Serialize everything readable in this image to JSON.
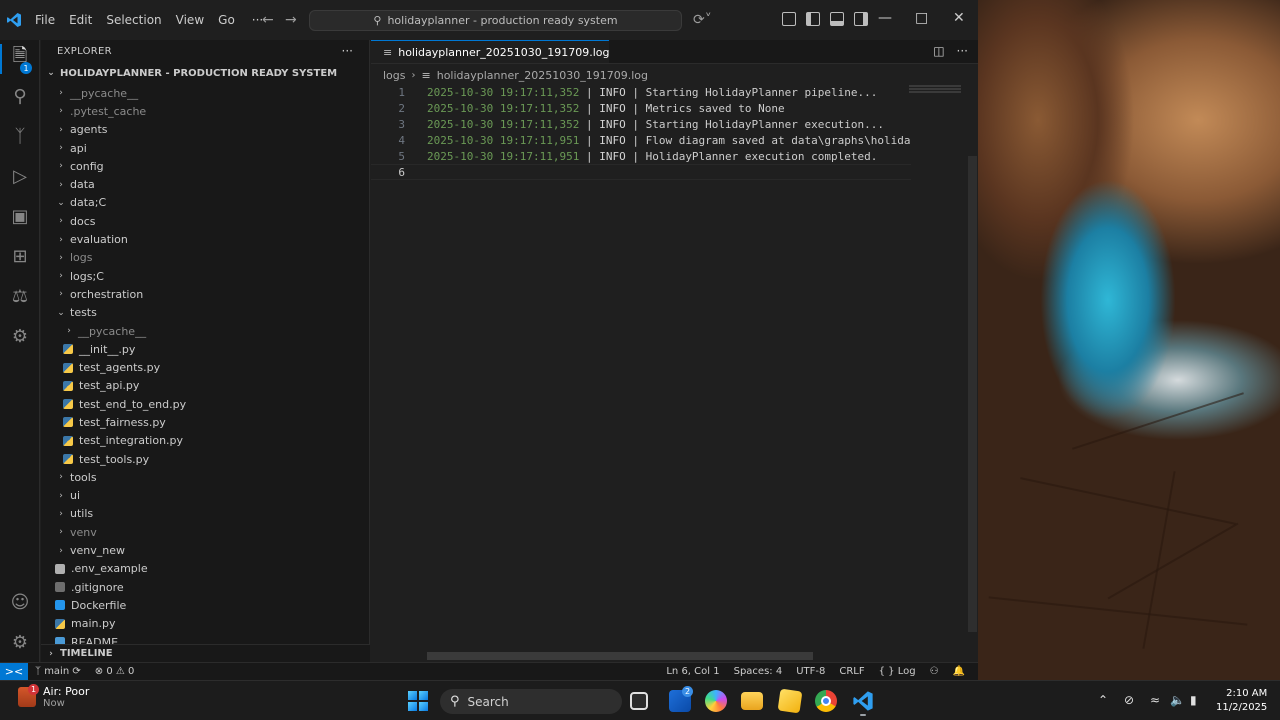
{
  "menu": {
    "file": "File",
    "edit": "Edit",
    "selection": "Selection",
    "view": "View",
    "go": "Go",
    "more": "···"
  },
  "command_center": {
    "text": "holidayplanner - production ready system"
  },
  "activity": {
    "explorer_badge": "1"
  },
  "sidebar": {
    "title": "EXPLORER",
    "more": "···",
    "root": "HOLIDAYPLANNER - PRODUCTION READY SYSTEM",
    "items": [
      {
        "label": "__pycache__",
        "type": "folder",
        "dim": true,
        "depth": 1,
        "open": false
      },
      {
        "label": ".pytest_cache",
        "type": "folder",
        "dim": true,
        "depth": 1,
        "open": false
      },
      {
        "label": "agents",
        "type": "folder",
        "dim": false,
        "depth": 1,
        "open": false
      },
      {
        "label": "api",
        "type": "folder",
        "dim": false,
        "depth": 1,
        "open": false
      },
      {
        "label": "config",
        "type": "folder",
        "dim": false,
        "depth": 1,
        "open": false
      },
      {
        "label": "data",
        "type": "folder",
        "dim": false,
        "depth": 1,
        "open": false
      },
      {
        "label": "data;C",
        "type": "folder",
        "dim": false,
        "depth": 1,
        "open": true
      },
      {
        "label": "docs",
        "type": "folder",
        "dim": false,
        "depth": 1,
        "open": false
      },
      {
        "label": "evaluation",
        "type": "folder",
        "dim": false,
        "depth": 1,
        "open": false
      },
      {
        "label": "logs",
        "type": "folder",
        "dim": true,
        "depth": 1,
        "open": false
      },
      {
        "label": "logs;C",
        "type": "folder",
        "dim": false,
        "depth": 1,
        "open": false
      },
      {
        "label": "orchestration",
        "type": "folder",
        "dim": false,
        "depth": 1,
        "open": false
      },
      {
        "label": "tests",
        "type": "folder",
        "dim": false,
        "depth": 1,
        "open": true
      },
      {
        "label": "__pycache__",
        "type": "folder",
        "dim": true,
        "depth": 2,
        "open": false
      },
      {
        "label": "__init__.py",
        "type": "py",
        "dim": false,
        "depth": 2
      },
      {
        "label": "test_agents.py",
        "type": "py",
        "dim": false,
        "depth": 2
      },
      {
        "label": "test_api.py",
        "type": "py",
        "dim": false,
        "depth": 2
      },
      {
        "label": "test_end_to_end.py",
        "type": "py",
        "dim": false,
        "depth": 2
      },
      {
        "label": "test_fairness.py",
        "type": "py",
        "dim": false,
        "depth": 2
      },
      {
        "label": "test_integration.py",
        "type": "py",
        "dim": false,
        "depth": 2
      },
      {
        "label": "test_tools.py",
        "type": "py",
        "dim": false,
        "depth": 2
      },
      {
        "label": "tools",
        "type": "folder",
        "dim": false,
        "depth": 1,
        "open": false
      },
      {
        "label": "ui",
        "type": "folder",
        "dim": false,
        "depth": 1,
        "open": false
      },
      {
        "label": "utils",
        "type": "folder",
        "dim": false,
        "depth": 1,
        "open": false
      },
      {
        "label": "venv",
        "type": "folder",
        "dim": true,
        "depth": 1,
        "open": false
      },
      {
        "label": "venv_new",
        "type": "folder",
        "dim": false,
        "depth": 1,
        "open": false
      },
      {
        "label": ".env_example",
        "type": "env",
        "dim": false,
        "depth": 1
      },
      {
        "label": ".gitignore",
        "type": "git",
        "dim": false,
        "depth": 1
      },
      {
        "label": "Dockerfile",
        "type": "docker",
        "dim": false,
        "depth": 1
      },
      {
        "label": "main.py",
        "type": "py",
        "dim": false,
        "depth": 1
      },
      {
        "label": "README",
        "type": "md",
        "dim": false,
        "depth": 1
      }
    ],
    "timeline": "TIMELINE"
  },
  "editor": {
    "tab_label": "holidayplanner_20251030_191709.log",
    "breadcrumb_folder": "logs",
    "breadcrumb_file": "holidayplanner_20251030_191709.log",
    "lines": [
      {
        "num": "1",
        "ts": "2025-10-30 19:17:11,352",
        "level": "INFO",
        "msg": "Starting HolidayPlanner pipeline..."
      },
      {
        "num": "2",
        "ts": "2025-10-30 19:17:11,352",
        "level": "INFO",
        "msg": "Metrics saved to None"
      },
      {
        "num": "3",
        "ts": "2025-10-30 19:17:11,352",
        "level": "INFO",
        "msg": "Starting HolidayPlanner execution..."
      },
      {
        "num": "4",
        "ts": "2025-10-30 19:17:11,951",
        "level": "INFO",
        "msg": "Flow diagram saved at data\\graphs\\holiday_p"
      },
      {
        "num": "5",
        "ts": "2025-10-30 19:17:11,951",
        "level": "INFO",
        "msg": "HolidayPlanner execution completed."
      },
      {
        "num": "6",
        "ts": "",
        "level": "",
        "msg": ""
      }
    ]
  },
  "status": {
    "remote": "><",
    "branch": "main",
    "errors": "0",
    "warnings": "0",
    "position": "Ln 6, Col 1",
    "spaces": "Spaces: 4",
    "encoding": "UTF-8",
    "eol": "CRLF",
    "language": "Log"
  },
  "taskbar": {
    "weather_title": "Air: Poor",
    "weather_sub": "Now",
    "weather_badge": "1",
    "search": "Search",
    "store_badge": "2",
    "time": "2:10 AM",
    "date": "11/2/2025"
  },
  "colors": {
    "accent": "#0078d4",
    "timestamp": "#6a9955",
    "window_bg": "#1f1f1f",
    "sidebar_bg": "#181818"
  }
}
